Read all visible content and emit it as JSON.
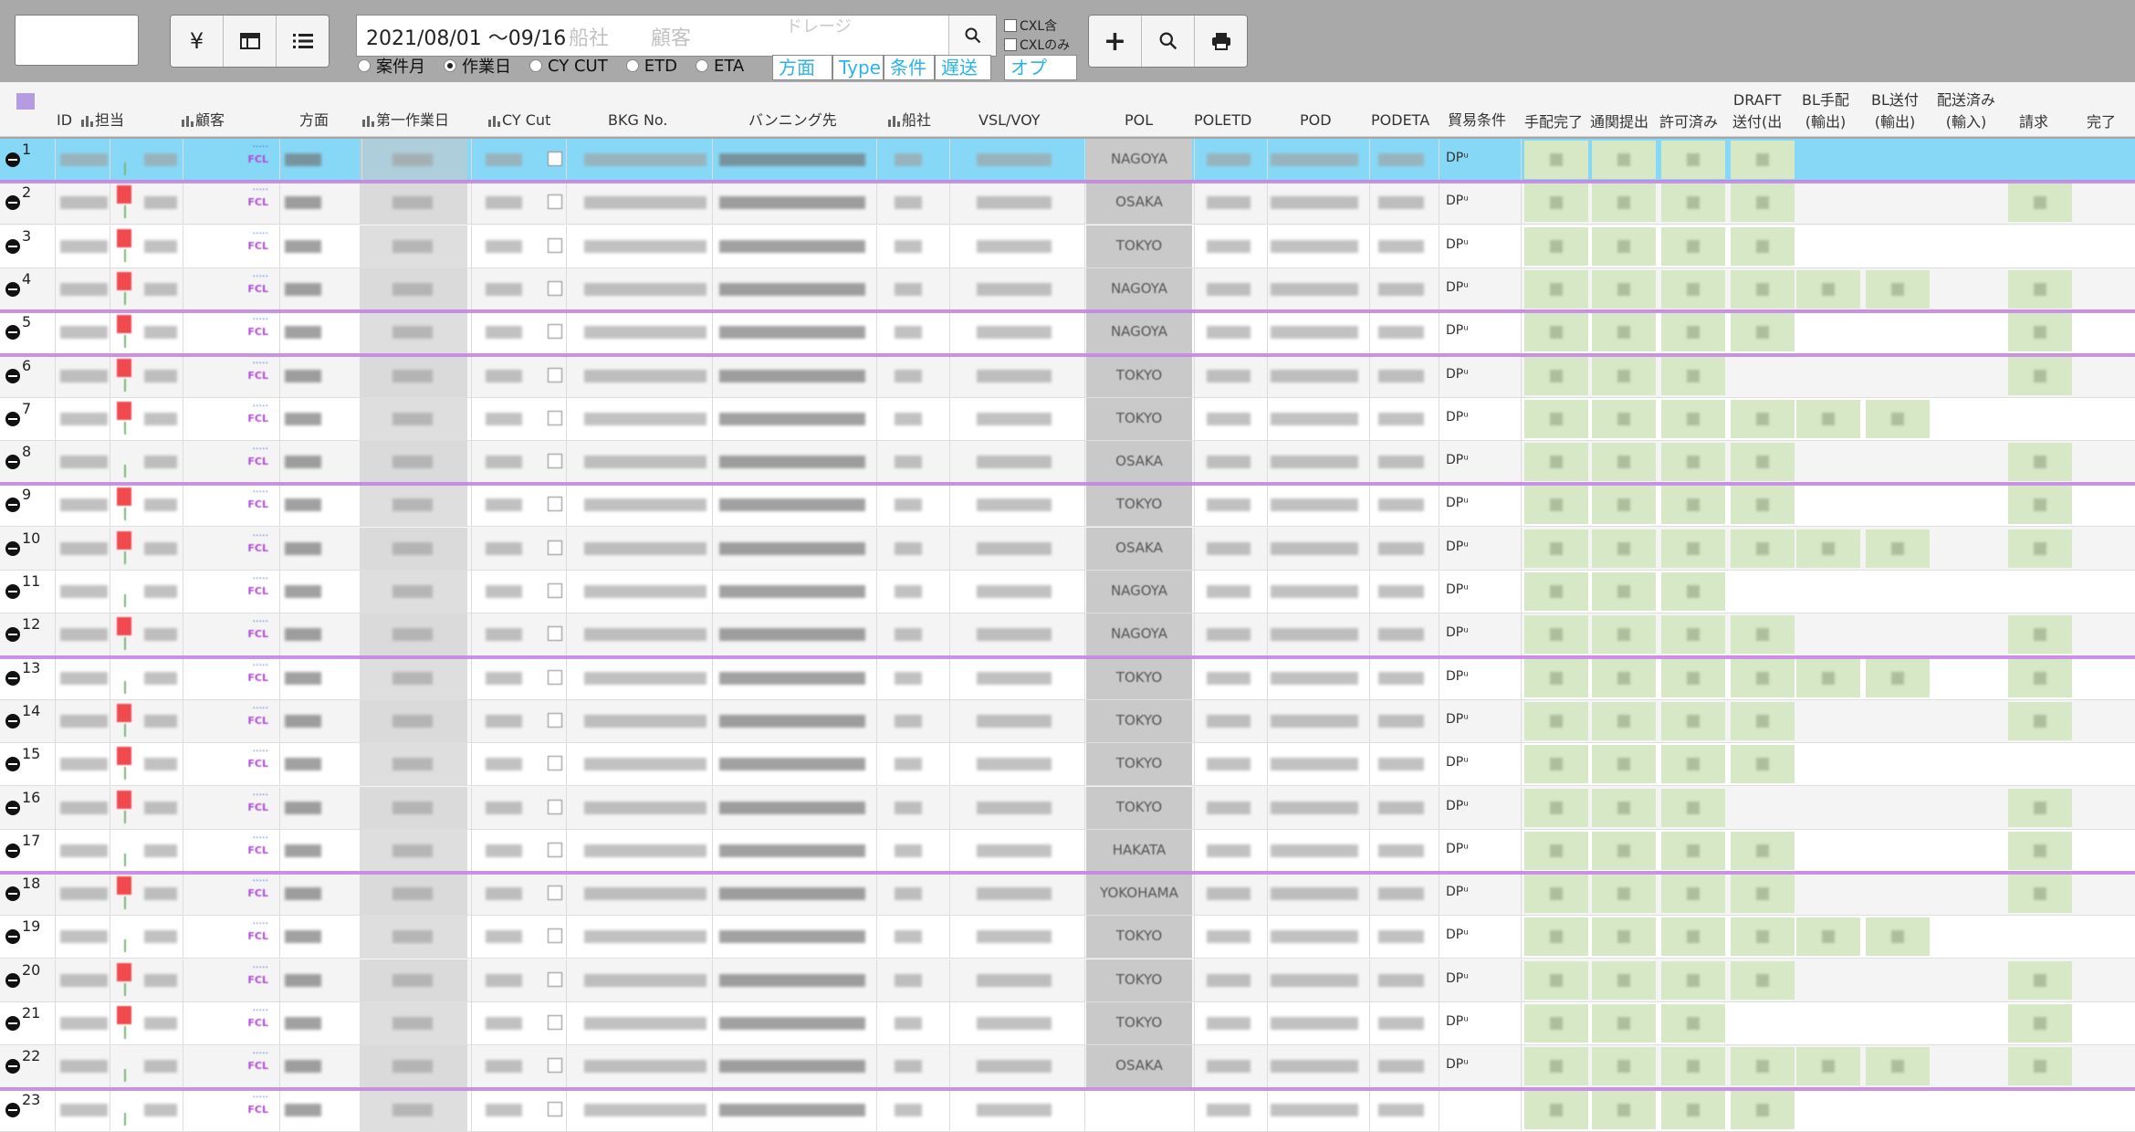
{
  "toolbar": {
    "icon_buttons": [
      "yen-icon",
      "calendar-icon",
      "list-icon"
    ],
    "right_buttons": [
      "plus-icon",
      "search-icon",
      "print-icon"
    ],
    "date_range": "2021/08/01 ～09/16",
    "placeholder_carrier": "船社",
    "placeholder_customer": "顧客",
    "placeholder_drayage": "ドレージ",
    "cxl_include": "CXL含",
    "cxl_only": "CXLのみ",
    "radios": [
      {
        "label": "案件月",
        "checked": false
      },
      {
        "label": "作業日",
        "checked": true
      },
      {
        "label": "CY CUT",
        "checked": false
      },
      {
        "label": "ETD",
        "checked": false
      },
      {
        "label": "ETA",
        "checked": false
      }
    ],
    "filter_direction": "方面",
    "filter_type": "Type",
    "filter_condition": "条件",
    "filter_delay": "遅送",
    "filter_option": "オプ"
  },
  "header": {
    "id": "ID",
    "staff": "担当",
    "customer": "顧客",
    "direction": "方面",
    "first_work_day": "第一作業日",
    "cy_cut": "CY Cut",
    "bkg_no": "BKG  No.",
    "vanning": "バンニング先",
    "carrier": "船社",
    "vsl_voy": "VSL/VOY",
    "pol": "POL",
    "poletd": "POLETD",
    "pod": "POD",
    "podeta": "PODETA",
    "trade_terms": "貿易条件",
    "arranged": "手配完了",
    "customs": "通関提出",
    "permitted": "許可済み",
    "draft_1": "DRAFT",
    "draft_2": "送付(出",
    "bl_arrange_1": "BL手配",
    "bl_arrange_2": "(輸出)",
    "bl_send_1": "BL送付",
    "bl_send_2": "(輸出)",
    "delivered_1": "配送済み",
    "delivered_2": "(輸入)",
    "billing": "請求",
    "done": "完了"
  },
  "rows": [
    {
      "num": "1",
      "pol": "NAGOYA",
      "terms": "DPᵘ"
    },
    {
      "num": "2",
      "pol": "OSAKA",
      "terms": "DPᵘ"
    },
    {
      "num": "3",
      "pol": "TOKYO",
      "terms": "DPᵘ"
    },
    {
      "num": "4",
      "pol": "NAGOYA",
      "terms": "DPᵘ"
    },
    {
      "num": "5",
      "pol": "NAGOYA",
      "terms": "DPᵘ"
    },
    {
      "num": "6",
      "pol": "TOKYO",
      "terms": "DPᵘ"
    },
    {
      "num": "7",
      "pol": "TOKYO",
      "terms": "DPᵘ"
    },
    {
      "num": "8",
      "pol": "OSAKA",
      "terms": "DPᵘ"
    },
    {
      "num": "9",
      "pol": "TOKYO",
      "terms": "DPᵘ"
    },
    {
      "num": "10",
      "pol": "OSAKA",
      "terms": "DPᵘ"
    },
    {
      "num": "11",
      "pol": "NAGOYA",
      "terms": "DPᵘ"
    },
    {
      "num": "12",
      "pol": "NAGOYA",
      "terms": "DPᵘ"
    },
    {
      "num": "13",
      "pol": "TOKYO",
      "terms": "DPᵘ"
    },
    {
      "num": "14",
      "pol": "TOKYO",
      "terms": "DPᵘ"
    },
    {
      "num": "15",
      "pol": "TOKYO",
      "terms": "DPᵘ"
    },
    {
      "num": "16",
      "pol": "TOKYO",
      "terms": "DPᵘ"
    },
    {
      "num": "17",
      "pol": "HAKATA",
      "terms": "DPᵘ"
    },
    {
      "num": "18",
      "pol": "YOKOHAMA",
      "terms": "DPᵘ"
    },
    {
      "num": "19",
      "pol": "TOKYO",
      "terms": "DPᵘ"
    },
    {
      "num": "20",
      "pol": "TOKYO",
      "terms": "DPᵘ"
    },
    {
      "num": "21",
      "pol": "TOKYO",
      "terms": "DPᵘ"
    },
    {
      "num": "22",
      "pol": "OSAKA",
      "terms": "DPᵘ"
    },
    {
      "num": "23",
      "pol": "",
      "terms": ""
    }
  ],
  "colors": {
    "selected_row": "#87d8f7",
    "group_separator": "#c37fe0",
    "status_done": "#d6e8c6",
    "filter_text": "#2bb3e8"
  }
}
